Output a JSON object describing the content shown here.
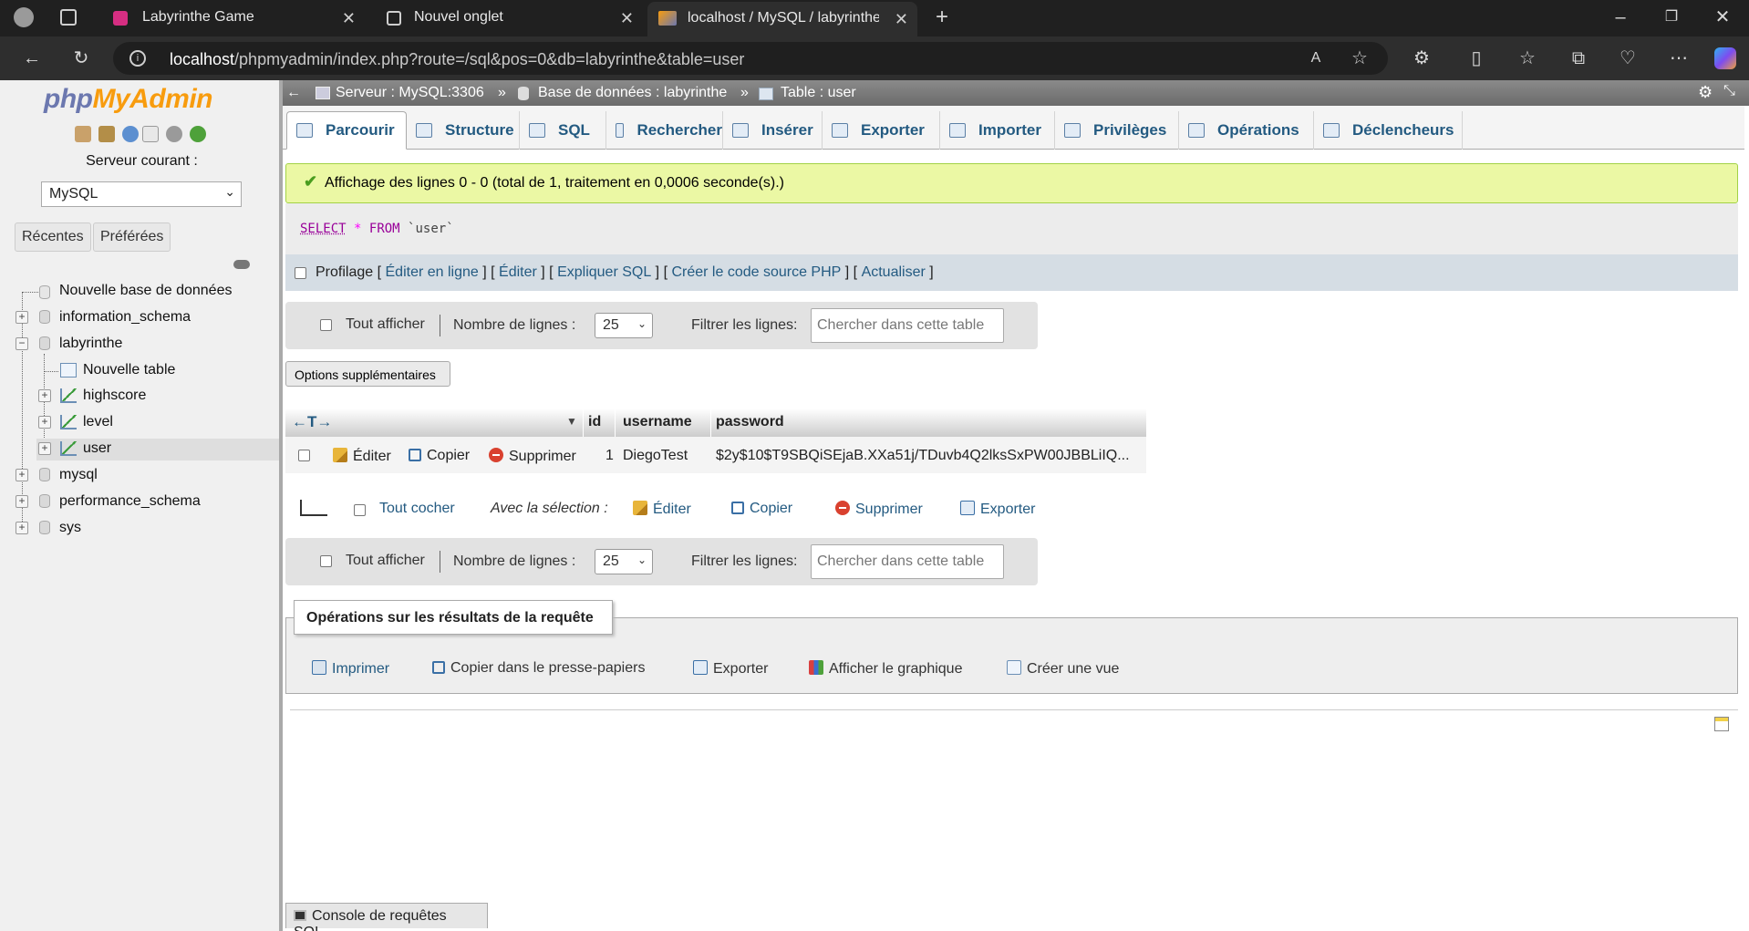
{
  "browser": {
    "tabs": [
      {
        "title": "Labyrinthe Game"
      },
      {
        "title": "Nouvel onglet"
      },
      {
        "title": "localhost / MySQL / labyrinthe / user"
      }
    ],
    "url_host": "localhost",
    "url_path": "/phpmyadmin/index.php?route=/sql&pos=0&db=labyrinthe&table=user"
  },
  "sidebar": {
    "logo_php": "php",
    "logo_admin": "MyAdmin",
    "server_label": "Serveur courant :",
    "server_value": "MySQL",
    "recent": "Récentes",
    "favorites": "Préférées",
    "tree": {
      "new_db": "Nouvelle base de données",
      "information_schema": "information_schema",
      "labyrinthe": "labyrinthe",
      "new_table": "Nouvelle table",
      "highscore": "highscore",
      "level": "level",
      "user": "user",
      "mysql": "mysql",
      "performance_schema": "performance_schema",
      "sys": "sys"
    }
  },
  "breadcrumb": {
    "server": "Serveur : MySQL:3306",
    "database": "Base de données : labyrinthe",
    "table": "Table : user",
    "sep": "»"
  },
  "menu": {
    "browse": "Parcourir",
    "structure": "Structure",
    "sql": "SQL",
    "search": "Rechercher",
    "insert": "Insérer",
    "export": "Exporter",
    "import": "Importer",
    "privileges": "Privilèges",
    "operations": "Opérations",
    "triggers": "Déclencheurs"
  },
  "result": {
    "message": "Affichage des lignes 0 - 0 (total de 1, traitement en 0,0006 seconde(s).)",
    "query_select": "SELECT",
    "query_star": "*",
    "query_from": "FROM",
    "query_table": "`user`"
  },
  "profiling": {
    "label": "Profilage",
    "edit_inline": "Éditer en ligne",
    "edit": "Éditer",
    "explain": "Expliquer SQL",
    "php_code": "Créer le code source PHP",
    "refresh": "Actualiser"
  },
  "nav": {
    "show_all": "Tout afficher",
    "rows_label": "Nombre de lignes :",
    "rows_value": "25",
    "filter_label": "Filtrer les lignes:",
    "filter_placeholder": "Chercher dans cette table"
  },
  "extra_options": "Options supplémentaires",
  "table": {
    "columns": [
      "id",
      "username",
      "password"
    ],
    "row": {
      "edit": "Éditer",
      "copy": "Copier",
      "delete": "Supprimer",
      "id": "1",
      "username": "DiegoTest",
      "password": "$2y$10$T9SBQiSEjaB.XXa51j/TDuvb4Q2lksSxPW00JBBLiIQ..."
    }
  },
  "selection": {
    "check_all": "Tout cocher",
    "with_selection": "Avec la sélection :",
    "edit": "Éditer",
    "copy": "Copier",
    "delete": "Supprimer",
    "export": "Exporter"
  },
  "query_ops": {
    "legend": "Opérations sur les résultats de la requête",
    "print": "Imprimer",
    "copy_clipboard": "Copier dans le presse-papiers",
    "export": "Exporter",
    "chart": "Afficher le graphique",
    "create_view": "Créer une vue"
  },
  "console": "Console de requêtes SQL",
  "colors": {
    "accent": "#235a81",
    "success_bg": "#ebf8a4",
    "delete_red": "#d9412f",
    "logo_blue": "#6c78af",
    "logo_orange": "#f89c0e"
  }
}
